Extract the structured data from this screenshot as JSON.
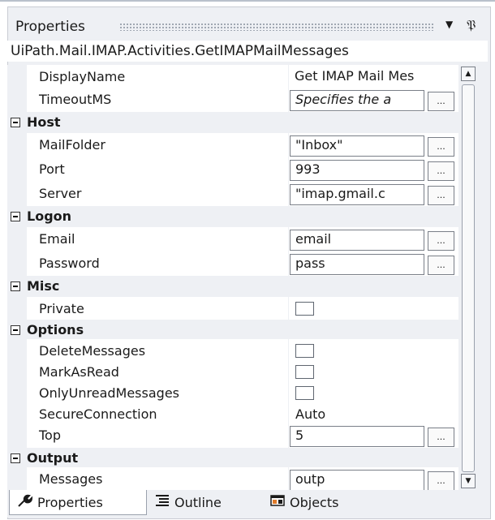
{
  "panel": {
    "title": "Properties",
    "dropdown_icon": "▼",
    "pin_icon": "📌",
    "type_name": "UiPath.Mail.IMAP.Activities.GetIMAPMailMessages"
  },
  "rows": {
    "display_name": {
      "label": "DisplayName",
      "value": "Get IMAP Mail Mes"
    },
    "timeout": {
      "label": "TimeoutMS",
      "value": "Specifies the a"
    },
    "host": {
      "label": "Host"
    },
    "mail_folder": {
      "label": "MailFolder",
      "value": "\"Inbox\""
    },
    "port": {
      "label": "Port",
      "value": "993"
    },
    "server": {
      "label": "Server",
      "value": "\"imap.gmail.c"
    },
    "logon": {
      "label": "Logon"
    },
    "email": {
      "label": "Email",
      "value": "email"
    },
    "password": {
      "label": "Password",
      "value": "pass"
    },
    "misc": {
      "label": "Misc"
    },
    "private": {
      "label": "Private",
      "checked": false
    },
    "options": {
      "label": "Options"
    },
    "delete_messages": {
      "label": "DeleteMessages",
      "checked": false
    },
    "mark_as_read": {
      "label": "MarkAsRead",
      "checked": false
    },
    "only_unread": {
      "label": "OnlyUnreadMessages",
      "checked": false
    },
    "secure_connection": {
      "label": "SecureConnection",
      "value": "Auto"
    },
    "top": {
      "label": "Top",
      "value": "5"
    },
    "output": {
      "label": "Output"
    },
    "messages": {
      "label": "Messages",
      "value": "outp"
    }
  },
  "ellipsis": "...",
  "tabs": [
    {
      "label": "Properties",
      "icon": "wrench-icon",
      "active": true
    },
    {
      "label": "Outline",
      "icon": "outline-icon",
      "active": false
    },
    {
      "label": "Objects",
      "icon": "objects-icon",
      "active": false
    }
  ]
}
